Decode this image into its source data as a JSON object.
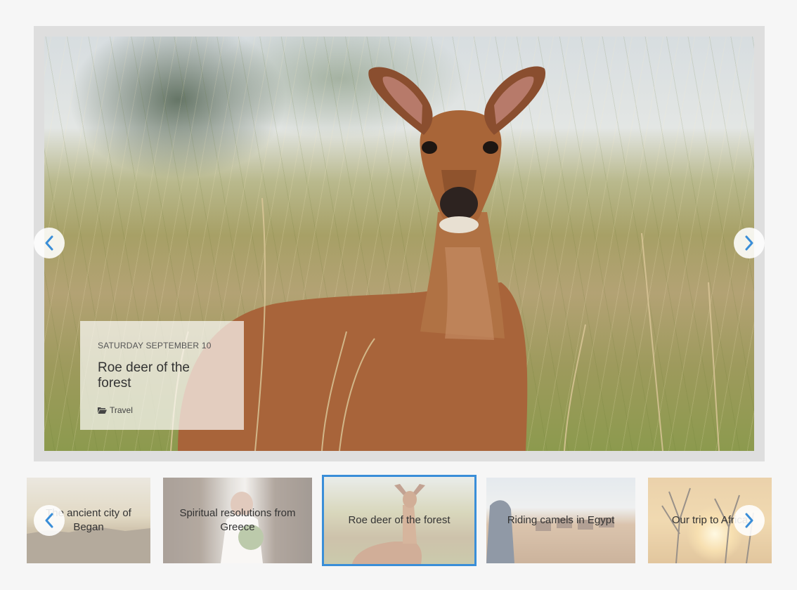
{
  "main_slide": {
    "date": "SATURDAY SEPTEMBER 10",
    "title": "Roe deer of the forest",
    "category": "Travel",
    "category_icon": "folder-open-icon"
  },
  "controls": {
    "prev_icon": "chevron-left-icon",
    "next_icon": "chevron-right-icon",
    "accent_color": "#3a8ed8"
  },
  "thumbnails": [
    {
      "label": "The ancient city of Began",
      "active": false
    },
    {
      "label": "Spiritual resolutions from Greece",
      "active": false
    },
    {
      "label": "Roe deer of the forest",
      "active": true
    },
    {
      "label": "Riding camels in Egypt",
      "active": false
    },
    {
      "label": "Our trip to Africa",
      "active": false
    }
  ]
}
